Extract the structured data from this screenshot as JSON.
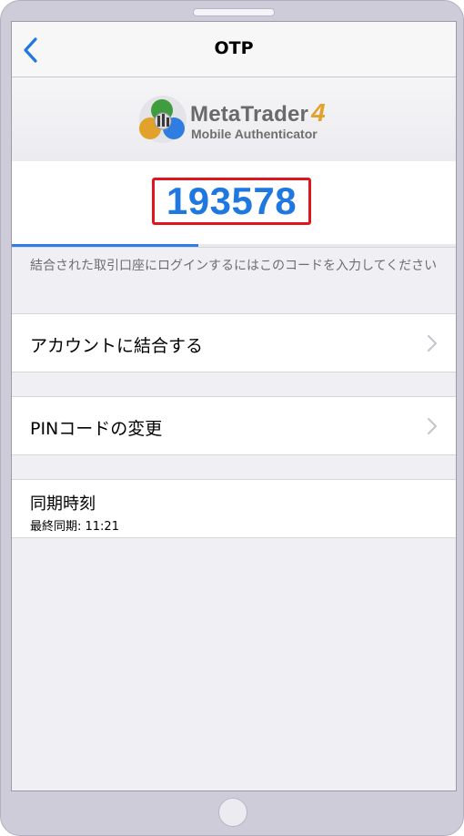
{
  "nav": {
    "title": "OTP",
    "back_icon": "chevron-left-icon"
  },
  "brand": {
    "name": "MetaTrader",
    "version": "4",
    "subtitle": "Mobile Authenticator",
    "logo_icon": "metatrader-logo"
  },
  "otp": {
    "code": "193578",
    "progress_fraction": 0.42,
    "hint": "結合された取引口座にログインするにはこのコードを入力してください"
  },
  "menu": {
    "link_account": "アカウントに結合する",
    "change_pin": "PINコードの変更",
    "chevron_icon": "chevron-right-icon"
  },
  "sync": {
    "title": "同期時刻",
    "last_sync": "最終同期: 11:21"
  },
  "colors": {
    "accent_blue": "#1f78e0",
    "otp_frame_red": "#e0161d",
    "brand_orange": "#e2a12a"
  }
}
